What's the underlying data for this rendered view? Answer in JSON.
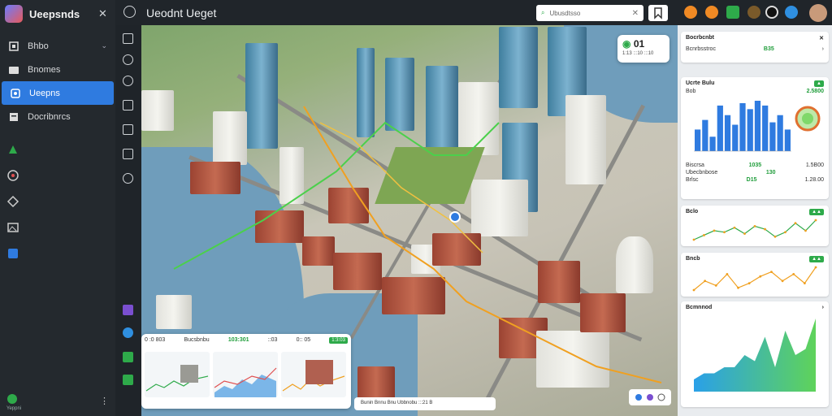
{
  "sidebar": {
    "brand": "Ueepsnds",
    "items": [
      {
        "label": "Bhbo",
        "icon": "layers-icon"
      },
      {
        "label": "Bnomes",
        "icon": "folder-icon"
      },
      {
        "label": "Ueepns",
        "icon": "map-pin-icon"
      },
      {
        "label": "Docribnrcs",
        "icon": "document-icon"
      }
    ],
    "footer": "Yeppni"
  },
  "topbar": {
    "title": "Ueodnt Ueget",
    "search_text": "Ubusdtsso",
    "accent": "#2f7be0"
  },
  "map_widgets": {
    "top_value": "01",
    "top_sub": "1:13  :::10  :::10",
    "bottom": {
      "title": "Bucsbnbu",
      "values": [
        "0 :0 803",
        "103:301",
        "::03",
        "0:: 05",
        "1:3:03"
      ],
      "pill": ""
    },
    "status": "Bunin Bnnu  Bnu  Ubbnobu  :::21 B"
  },
  "rpanel": {
    "card1": {
      "title": "Bocrbcnbt",
      "label": "Bcnrbsstroc",
      "value": "B35"
    },
    "card2": {
      "title": "Ucrte Bulu",
      "head_left": "Bob",
      "head_value": "2.5800",
      "bars": [
        18,
        26,
        12,
        38,
        30,
        22,
        40,
        35,
        42,
        38,
        24,
        30,
        18
      ],
      "rows": [
        {
          "label": "Biscrsa",
          "mid": "1035",
          "value": "1.5B00"
        },
        {
          "label": "Ubecbnbose",
          "mid": "130",
          "value": ""
        },
        {
          "label": "Brlsc",
          "mid": "D15",
          "value": "1.28.00"
        }
      ]
    },
    "card3": {
      "title": "Bclo",
      "line": [
        3,
        6,
        9,
        8,
        11,
        7,
        12,
        10,
        5,
        8,
        14,
        9,
        16
      ]
    },
    "card4": {
      "title": "Bncb",
      "line": [
        5,
        9,
        7,
        12,
        6,
        8,
        11,
        13,
        9,
        12,
        8,
        15
      ]
    },
    "card5": {
      "title": "Bcmnnod",
      "area": [
        2,
        3,
        3,
        4,
        4,
        6,
        5,
        9,
        4,
        10,
        6,
        7,
        12
      ]
    }
  }
}
